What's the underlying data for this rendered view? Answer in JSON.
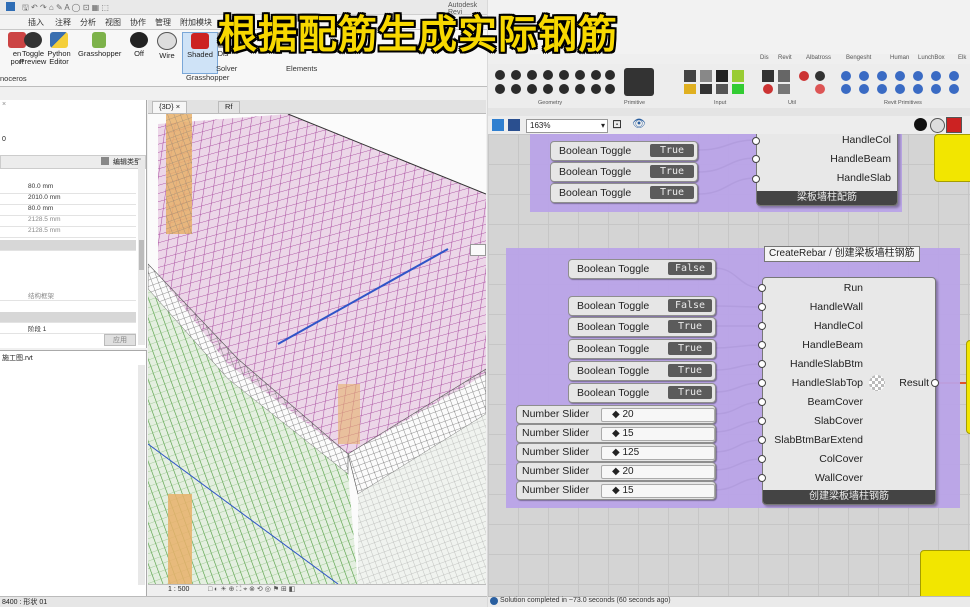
{
  "overlay_title": "根据配筋生成实际钢筋",
  "revit": {
    "app_title": "Autodesk Revi",
    "tabs": [
      "插入",
      "注释",
      "分析",
      "视图",
      "协作",
      "管理",
      "附加模块"
    ],
    "ribbon_buttons": [
      {
        "label": "en\nport",
        "icon": "export-icon"
      },
      {
        "label": "Toggle\nPreview",
        "icon": "toggle-preview-icon"
      },
      {
        "label": "Python\nEditor",
        "icon": "python-icon"
      },
      {
        "label": "Grasshopper",
        "icon": "grasshopper-icon"
      },
      {
        "label": "Off",
        "icon": "off-icon"
      },
      {
        "label": "Wire",
        "icon": "wire-icon"
      },
      {
        "label": "Shaded",
        "icon": "shaded-icon"
      },
      {
        "label": "Dis",
        "icon": "display-icon"
      }
    ],
    "group_labels": [
      "noceros",
      "Grasshopper",
      "Solver",
      "Elements"
    ],
    "properties": {
      "edit_type": "编辑类型",
      "top_value": "0",
      "rows": [
        "80.0 mm",
        "2010.0 mm",
        "80.0 mm",
        "2128.5 mm",
        "2128.5 mm"
      ],
      "structural_frame": "结构框架",
      "level": "阶段 1",
      "apply": "应用"
    },
    "browser_file": "施工图.rvt",
    "view_tabs": [
      "{3D}",
      "Rf"
    ],
    "scale": "1 : 500",
    "status_text": "8400 : 形状 01",
    "accent": "#2f6db5"
  },
  "grasshopper": {
    "menu_items": [
      "Dis",
      "Revit",
      "Albatross",
      "Bengesht",
      "Human",
      "LunchBox",
      "Elk"
    ],
    "toolbar_groups": [
      "Geometry",
      "Primitive",
      "Input",
      "Util",
      "Revit Primitives"
    ],
    "zoom": "163%",
    "status": "Solution completed in ~73.0 seconds (60 seconds ago)",
    "group1": {
      "toggles": [
        {
          "label": "Boolean Toggle",
          "value": "True"
        },
        {
          "label": "Boolean Toggle",
          "value": "True"
        },
        {
          "label": "Boolean Toggle",
          "value": "True"
        }
      ],
      "ports": [
        "HandleCol",
        "HandleBeam",
        "HandleSlab"
      ],
      "footer": "梁板墙柱配筋"
    },
    "group2": {
      "title": "CreateRebar / 创建梁板墙柱钢筋",
      "run_toggle": {
        "label": "Boolean Toggle",
        "value": "False"
      },
      "toggles": [
        {
          "label": "Boolean Toggle",
          "value": "False"
        },
        {
          "label": "Boolean Toggle",
          "value": "True"
        },
        {
          "label": "Boolean Toggle",
          "value": "True"
        },
        {
          "label": "Boolean Toggle",
          "value": "True"
        },
        {
          "label": "Boolean Toggle",
          "value": "True"
        }
      ],
      "sliders": [
        {
          "label": "Number Slider",
          "value": "20"
        },
        {
          "label": "Number Slider",
          "value": "15"
        },
        {
          "label": "Number Slider",
          "value": "125"
        },
        {
          "label": "Number Slider",
          "value": "20"
        },
        {
          "label": "Number Slider",
          "value": "15"
        }
      ],
      "ports": [
        "Run",
        "HandleWall",
        "HandleCol",
        "HandleBeam",
        "HandleSlabBtm",
        "HandleSlabTop",
        "BeamCover",
        "SlabCover",
        "SlabBtmBarExtend",
        "ColCover",
        "WallCover"
      ],
      "output": "Result",
      "footer": "创建梁板墙柱钢筋"
    },
    "group_color": "#b9a3e8",
    "wire_output_color": "#e0532b"
  }
}
